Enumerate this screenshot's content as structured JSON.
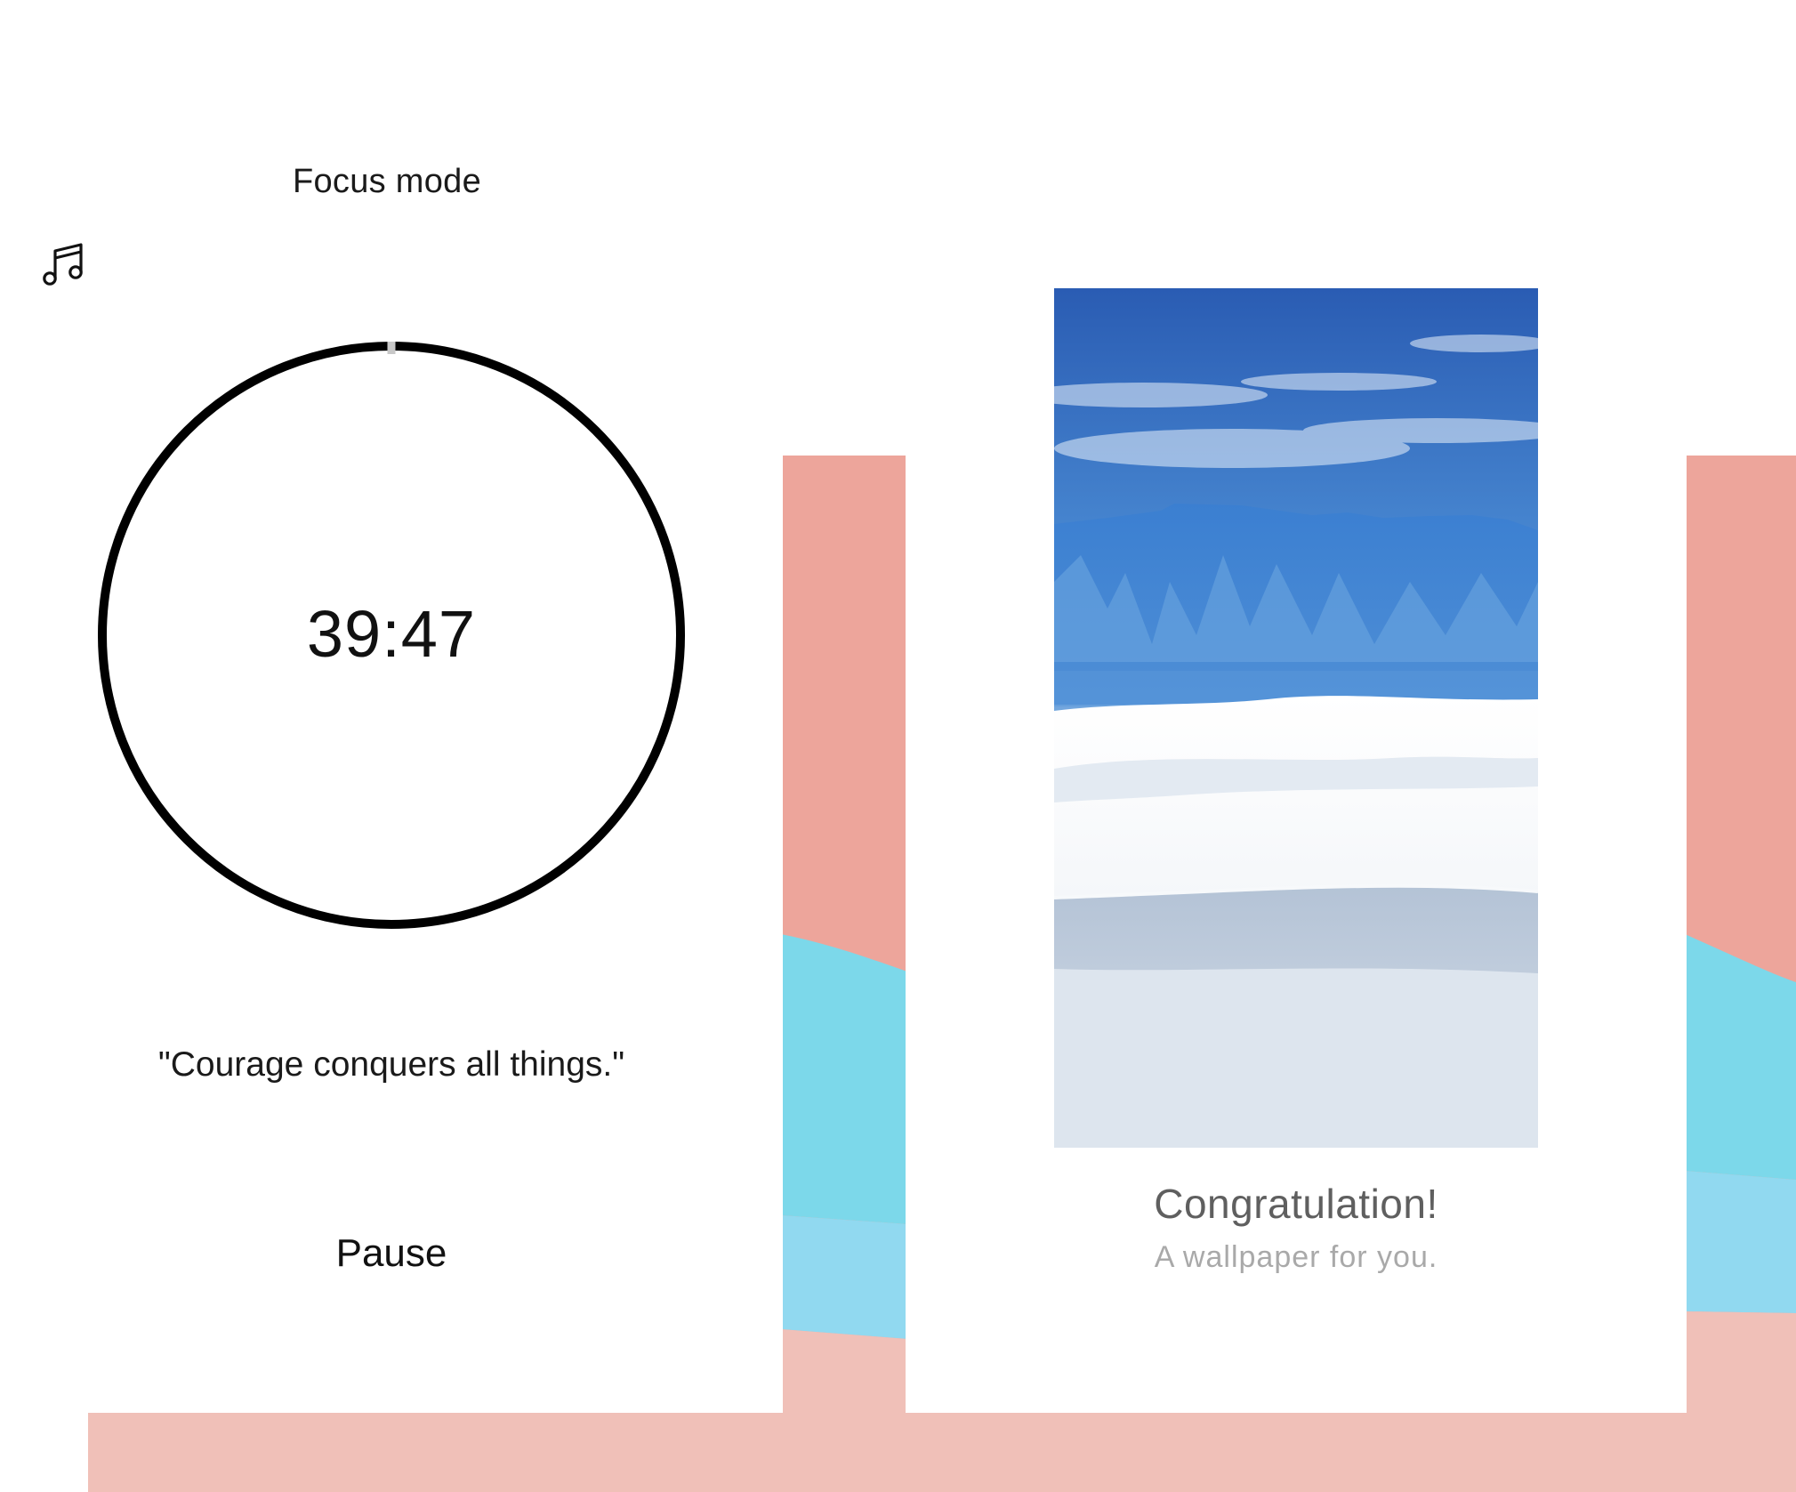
{
  "focus_screen": {
    "title": "Focus mode",
    "music_icon": "music-note-icon",
    "timer_text": "39:47",
    "quote": "\"Courage conquers all things.\"",
    "pause_label": "Pause"
  },
  "reward_screen": {
    "congrats": "Congratulation!",
    "subtitle": "A wallpaper for you."
  },
  "colors": {
    "salmon": "#EDA59B",
    "pale_pink": "#F0C0B8",
    "cyan": "#7CD8EA",
    "light_blue": "#91D9F0",
    "timer_ring": "#000000",
    "congrats_text": "#5F5F5F",
    "subtitle_text": "#A9A9A9"
  }
}
